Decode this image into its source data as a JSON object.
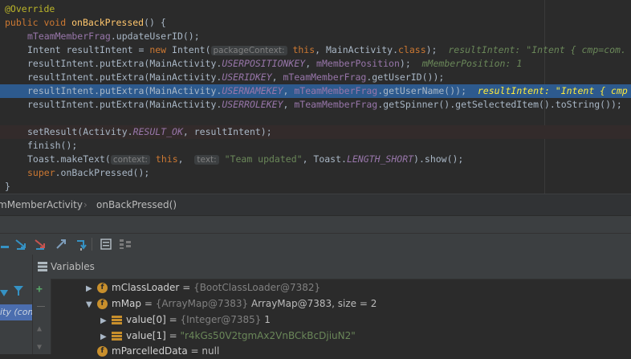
{
  "code": {
    "annotation": "@Override",
    "l1_kw": "public void ",
    "l1_fn": "onBackPressed",
    "l1_rest": "() {",
    "l2_fld": "mTeamMemberFrag",
    "l2_rest": ".updateUserID();",
    "l3_a": "Intent resultIntent = ",
    "l3_kw": "new",
    "l3_b": " Intent(",
    "l3_hint": "packageContext:",
    "l3_this": "this",
    "l3_c": ", MainActivity.",
    "l3_cls": "class",
    "l3_d": ");",
    "l3_inline": "resultIntent: \"Intent { cmp=com.",
    "l4_a": "resultIntent.putExtra(MainActivity.",
    "l4_const": "USERPOSITIONKEY",
    "l4_b": ", ",
    "l4_fld": "mMemberPosition",
    "l4_c": ");",
    "l4_inline": "mMemberPosition: 1",
    "l5_a": "resultIntent.putExtra(MainActivity.",
    "l5_const": "USERIDKEY",
    "l5_b": ", ",
    "l5_fld": "mTeamMemberFrag",
    "l5_c": ".getUserID());",
    "l6_a": "resultIntent.putExtra(MainActivity.",
    "l6_const": "USERNAMEKEY",
    "l6_b": ", ",
    "l6_fld": "mTeamMemberFrag",
    "l6_c": ".getUserName());",
    "l6_inline": "resultIntent: \"Intent { cmp",
    "l7_a": "resultIntent.putExtra(MainActivity.",
    "l7_const": "USERROLEKEY",
    "l7_b": ", ",
    "l7_fld": "mTeamMemberFrag",
    "l7_c": ".getSpinner().getSelectedItem().toString());",
    "l9_a": "setResult(Activity.",
    "l9_const": "RESULT_OK",
    "l9_b": ", resultIntent);",
    "l10": "finish();",
    "l11_a": "Toast.makeText(",
    "l11_hint1": "context:",
    "l11_this": "this",
    "l11_b": ", ",
    "l11_hint2": "text:",
    "l11_str": "\"Team updated\"",
    "l11_c": ", Toast.",
    "l11_const": "LENGTH_SHORT",
    "l11_d": ").show();",
    "l12_kw": "super",
    "l12_rest": ".onBackPressed();",
    "l13": "}"
  },
  "breadcrumb": {
    "item1": "mMemberActivity",
    "item2": "onBackPressed()"
  },
  "panel": {
    "variables_title": "Variables",
    "left_fragment": "ity (com"
  },
  "variables": [
    {
      "name": "mClassLoader",
      "eq": " = ",
      "type": "{BootClassLoader@7382}",
      "value": ""
    },
    {
      "name": "mMap",
      "eq": " = ",
      "type": "{ArrayMap@7383}",
      "value": " ArrayMap@7383, size = 2"
    },
    {
      "name": "value[0]",
      "eq": " = ",
      "type": "{Integer@7385}",
      "value": " 1"
    },
    {
      "name": "value[1]",
      "eq": " = ",
      "type": "",
      "value": "\"r4kGs50V2tgmAx2VnBCkBcDjiuN2\""
    },
    {
      "name": "mParcelledData",
      "eq": " = ",
      "type": "",
      "value": "null"
    }
  ],
  "colors": {
    "editor_bg": "#2b2b2b",
    "selection": "#2d5a8e",
    "keyword": "#cc7832",
    "string": "#6a8759",
    "field": "#9876aa",
    "method": "#ffc66d"
  }
}
